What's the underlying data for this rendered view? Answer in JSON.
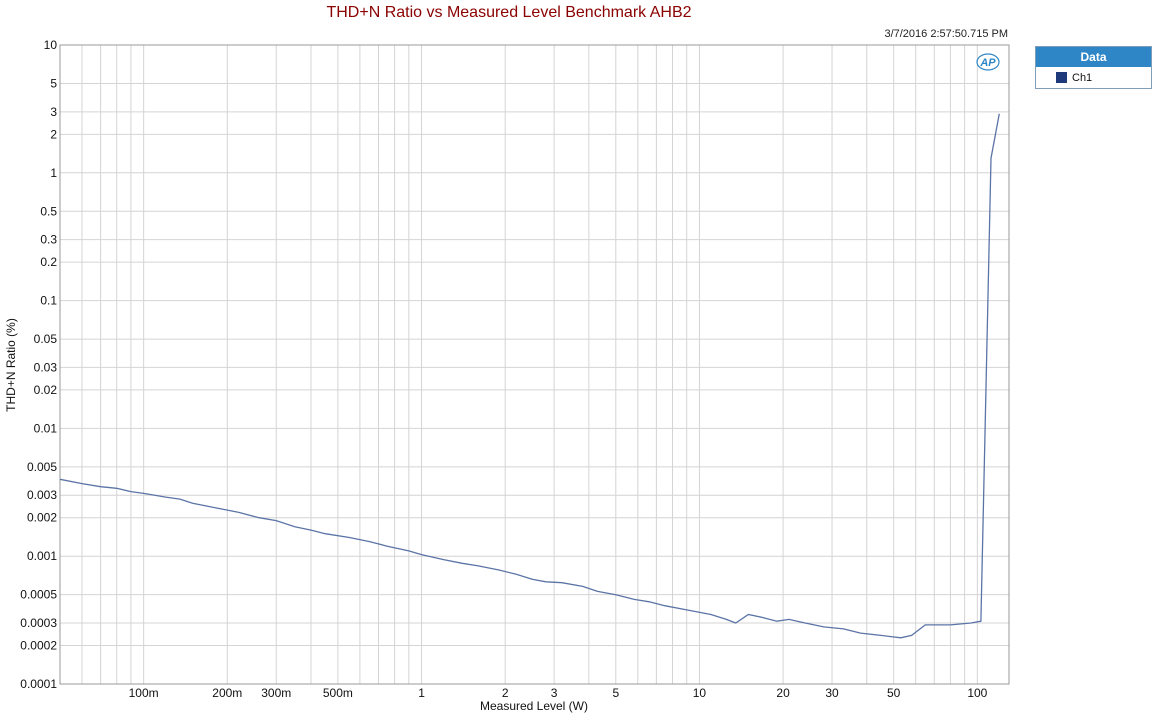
{
  "title": "THD+N Ratio vs Measured Level Benchmark AHB2",
  "timestamp": "3/7/2016 2:57:50.715 PM",
  "logo_text": "AP",
  "colors": {
    "series": "#5b74a6",
    "swatch": "#1f3a7a",
    "title": "#8b0000",
    "legend_header": "#2f86c6",
    "grid": "#d4d4d4"
  },
  "legend": {
    "header": "Data",
    "items": [
      {
        "name": "Ch1"
      }
    ]
  },
  "chart_data": {
    "type": "line",
    "title": "THD+N Ratio vs Measured Level Benchmark AHB2",
    "xlabel": "Measured Level (W)",
    "ylabel": "THD+N Ratio (%)",
    "x_scale": "log",
    "y_scale": "log",
    "xlim": [
      0.05,
      130
    ],
    "ylim": [
      0.0001,
      10
    ],
    "grid": true,
    "legend_position": "right",
    "x_ticks": [
      {
        "v": 0.1,
        "label": "100m"
      },
      {
        "v": 0.2,
        "label": "200m"
      },
      {
        "v": 0.3,
        "label": "300m"
      },
      {
        "v": 0.5,
        "label": "500m"
      },
      {
        "v": 1,
        "label": "1"
      },
      {
        "v": 2,
        "label": "2"
      },
      {
        "v": 3,
        "label": "3"
      },
      {
        "v": 5,
        "label": "5"
      },
      {
        "v": 10,
        "label": "10"
      },
      {
        "v": 20,
        "label": "20"
      },
      {
        "v": 30,
        "label": "30"
      },
      {
        "v": 50,
        "label": "50"
      },
      {
        "v": 100,
        "label": "100"
      }
    ],
    "y_ticks": [
      {
        "v": 10,
        "label": "10"
      },
      {
        "v": 5,
        "label": "5"
      },
      {
        "v": 3,
        "label": "3"
      },
      {
        "v": 2,
        "label": "2"
      },
      {
        "v": 1,
        "label": "1"
      },
      {
        "v": 0.5,
        "label": "0.5"
      },
      {
        "v": 0.3,
        "label": "0.3"
      },
      {
        "v": 0.2,
        "label": "0.2"
      },
      {
        "v": 0.1,
        "label": "0.1"
      },
      {
        "v": 0.05,
        "label": "0.05"
      },
      {
        "v": 0.03,
        "label": "0.03"
      },
      {
        "v": 0.02,
        "label": "0.02"
      },
      {
        "v": 0.01,
        "label": "0.01"
      },
      {
        "v": 0.005,
        "label": "0.005"
      },
      {
        "v": 0.003,
        "label": "0.003"
      },
      {
        "v": 0.002,
        "label": "0.002"
      },
      {
        "v": 0.001,
        "label": "0.001"
      },
      {
        "v": 0.0005,
        "label": "0.0005"
      },
      {
        "v": 0.0003,
        "label": "0.0003"
      },
      {
        "v": 0.0002,
        "label": "0.0002"
      },
      {
        "v": 0.0001,
        "label": "0.0001"
      }
    ],
    "series": [
      {
        "name": "Ch1",
        "x": [
          0.05,
          0.06,
          0.07,
          0.08,
          0.09,
          0.1,
          0.12,
          0.135,
          0.15,
          0.18,
          0.22,
          0.26,
          0.3,
          0.35,
          0.4,
          0.45,
          0.55,
          0.65,
          0.75,
          0.9,
          1.0,
          1.2,
          1.4,
          1.6,
          1.9,
          2.2,
          2.5,
          2.8,
          3.2,
          3.8,
          4.3,
          5.0,
          5.8,
          6.6,
          7.5,
          9.0,
          11,
          12.5,
          13.5,
          15.0,
          17,
          19,
          21,
          24,
          28,
          33,
          38,
          45,
          53,
          58,
          65,
          80,
          95,
          103,
          112,
          120
        ],
        "y": [
          0.004,
          0.0037,
          0.0035,
          0.0034,
          0.0032,
          0.0031,
          0.0029,
          0.0028,
          0.0026,
          0.0024,
          0.0022,
          0.002,
          0.0019,
          0.0017,
          0.0016,
          0.0015,
          0.0014,
          0.0013,
          0.0012,
          0.0011,
          0.00103,
          0.00094,
          0.00088,
          0.00084,
          0.00078,
          0.00072,
          0.00066,
          0.00063,
          0.00062,
          0.00058,
          0.00053,
          0.0005,
          0.00046,
          0.00044,
          0.00041,
          0.00038,
          0.00035,
          0.00032,
          0.0003,
          0.00035,
          0.00033,
          0.00031,
          0.00032,
          0.0003,
          0.00028,
          0.00027,
          0.00025,
          0.00024,
          0.00023,
          0.00024,
          0.00029,
          0.00029,
          0.0003,
          0.00031,
          1.3,
          2.9
        ]
      }
    ]
  }
}
